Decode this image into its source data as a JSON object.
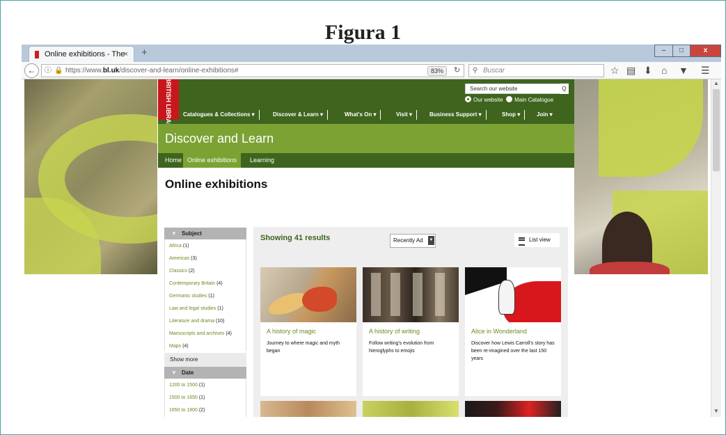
{
  "figure_caption": "Figura 1",
  "browser": {
    "tab_title": "Online exhibitions - The Bri...",
    "tab_close": "×",
    "new_tab": "+",
    "url_prefix": "https://www.",
    "url_domain": "bl.uk",
    "url_path": "/discover-and-learn/online-exhibitions#",
    "zoom": "83%",
    "search_placeholder": "Buscar",
    "window_buttons": {
      "minimize": "–",
      "maximize": "□",
      "close": "x"
    },
    "toolbar_icons": [
      "star-icon",
      "reading-list-icon",
      "download-icon",
      "home-icon",
      "pocket-icon",
      "menu-icon"
    ]
  },
  "site": {
    "logo": "BRITISH LIBRARY",
    "search_placeholder": "Search our website",
    "search_button": "Q",
    "scope_options": [
      "Our website",
      "Main Catalogue"
    ],
    "scope_selected": "Our website",
    "main_nav": [
      "Catalogues & Collections  ▾",
      "Discover & Learn  ▾",
      "What's On  ▾",
      "Visit  ▾",
      "Business Support  ▾",
      "Shop  ▾",
      "Join  ▾"
    ],
    "banner_title": "Discover and Learn",
    "sub_nav": [
      "Home",
      "Online exhibitions",
      "Learning"
    ],
    "sub_nav_active": "Online exhibitions",
    "page_title": "Online exhibitions",
    "facets": {
      "subject_title": "Subject",
      "subject_items": [
        {
          "label": "Africa",
          "count": "(1)"
        },
        {
          "label": "Americas",
          "count": "(3)"
        },
        {
          "label": "Classics",
          "count": "(2)"
        },
        {
          "label": "Contemporary Britain",
          "count": "(4)"
        },
        {
          "label": "Germanic studies",
          "count": "(1)"
        },
        {
          "label": "Law and legal studies",
          "count": "(1)"
        },
        {
          "label": "Literature and drama",
          "count": "(10)"
        },
        {
          "label": "Manuscripts and archives",
          "count": "(4)"
        },
        {
          "label": "Maps",
          "count": "(4)"
        }
      ],
      "show_more": "Show more",
      "date_title": "Date",
      "date_items": [
        {
          "label": "1200 to 1500",
          "count": "(1)"
        },
        {
          "label": "1500 to 1650",
          "count": "(1)"
        },
        {
          "label": "1650 to 1800",
          "count": "(2)"
        }
      ]
    },
    "results": {
      "showing": "Showing 41 results",
      "sort_value": "Recently Ad",
      "list_view": "List view",
      "cards": [
        {
          "title": "A history of magic",
          "desc": "Journey to where magic and myth began"
        },
        {
          "title": "A history of writing",
          "desc": "Follow writing's evolution from hieroglyphs to emojis"
        },
        {
          "title": "Alice in Wonderland",
          "desc": "Discover how Lewis Carroll's story has been re-imagined over the last 150 years"
        }
      ]
    }
  },
  "colors": {
    "header_green": "#3e641e",
    "banner_green": "#7ba233",
    "link_green": "#6b8a1f",
    "logo_red": "#c8171c"
  }
}
